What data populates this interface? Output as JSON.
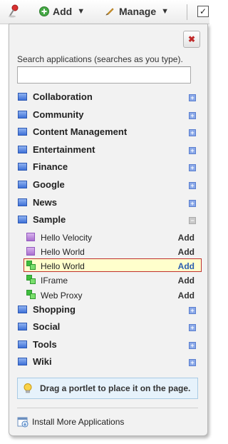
{
  "toolbar": {
    "pin_icon": "pushpin-icon",
    "add_label": "Add",
    "manage_label": "Manage"
  },
  "panel": {
    "close_icon": "close-icon",
    "search": {
      "label": "Search applications (searches as you type).",
      "value": "",
      "placeholder": ""
    },
    "categories": [
      {
        "label": "Collaboration"
      },
      {
        "label": "Community"
      },
      {
        "label": "Content Management"
      },
      {
        "label": "Entertainment"
      },
      {
        "label": "Finance"
      },
      {
        "label": "Google"
      },
      {
        "label": "News"
      },
      {
        "label": "Sample",
        "expanded": true
      },
      {
        "label": "Shopping"
      },
      {
        "label": "Social"
      },
      {
        "label": "Tools"
      },
      {
        "label": "Wiki"
      }
    ],
    "sample_apps": [
      {
        "label": "Hello Velocity",
        "add": "Add",
        "icon": "portlet-purple-icon"
      },
      {
        "label": "Hello World",
        "add": "Add",
        "icon": "portlet-purple-icon"
      },
      {
        "label": "Hello World",
        "add": "Add",
        "icon": "portlet-green-icon",
        "selected": true
      },
      {
        "label": "IFrame",
        "add": "Add",
        "icon": "portlet-green-icon"
      },
      {
        "label": "Web Proxy",
        "add": "Add",
        "icon": "portlet-green-icon"
      }
    ],
    "hint": "Drag a portlet to place it on the page.",
    "install_label": "Install More Applications"
  }
}
